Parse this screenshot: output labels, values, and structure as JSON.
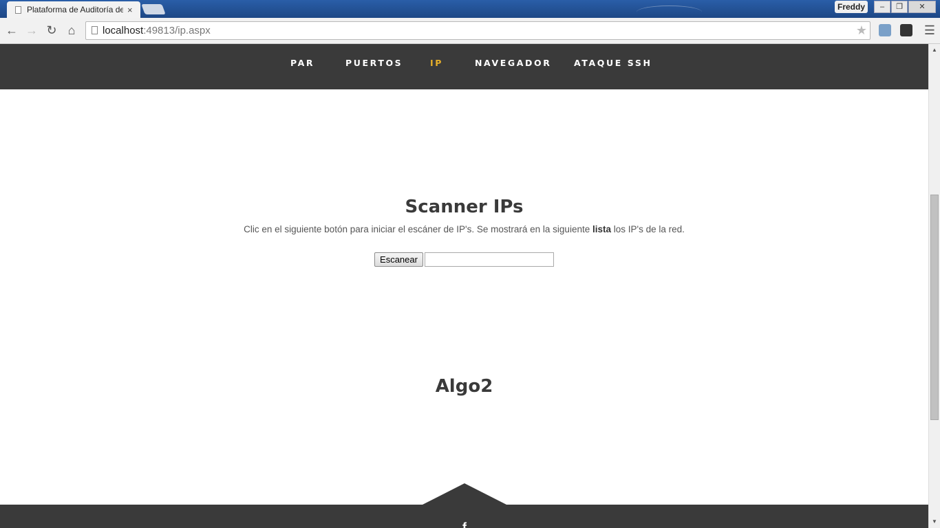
{
  "browser": {
    "tab_title": "Plataforma de Auditoría de",
    "tab_close": "×",
    "profile_name": "Freddy",
    "url_host": "localhost",
    "url_rest": ":49813/ip.aspx",
    "window_controls": {
      "minimize": "–",
      "restore": "❐",
      "close": "✕"
    },
    "nav_icons": [
      "back-icon",
      "forward-icon",
      "reload-icon",
      "home-icon"
    ]
  },
  "nav": {
    "items": [
      {
        "label": "PAR",
        "active": false
      },
      {
        "label": "PUERTOS",
        "active": false
      },
      {
        "label": "IP",
        "active": true
      },
      {
        "label": "NAVEGADOR",
        "active": false
      },
      {
        "label": "ATAQUE SSH",
        "active": false
      }
    ],
    "active_color": "#e8b02a",
    "bg_color": "#3a3a3a"
  },
  "scanner": {
    "title": "Scanner IPs",
    "description_before": "Clic en el siguiente botón para iniciar el escáner de IP's. Se mostrará en la siguiente ",
    "description_bold": "lista",
    "description_after": " los IP's de la red.",
    "button_label": "Escanear",
    "input_value": ""
  },
  "section2": {
    "title": "Algo2"
  },
  "footer": {
    "icon": "f"
  }
}
